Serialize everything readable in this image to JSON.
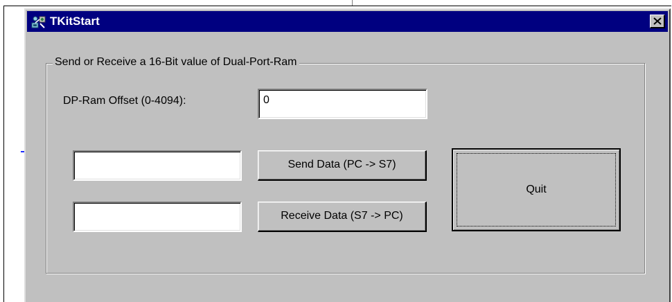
{
  "window": {
    "title": "TKitStart",
    "close_glyph": "×"
  },
  "group": {
    "label": "Send or Receive a 16-Bit value of Dual-Port-Ram"
  },
  "offset": {
    "label": "DP-Ram Offset (0-4094):",
    "value": "0"
  },
  "send": {
    "field_value": "",
    "button_label": "Send Data (PC -> S7)"
  },
  "receive": {
    "field_value": "",
    "button_label": "Receive Data (S7 -> PC)"
  },
  "quit": {
    "button_label": "Quit"
  },
  "icons": {
    "title": "application-icon",
    "close": "close-icon"
  },
  "colors": {
    "titlebar": "#000080",
    "face": "#c0c0c0",
    "window_bg": "#ffffff"
  }
}
